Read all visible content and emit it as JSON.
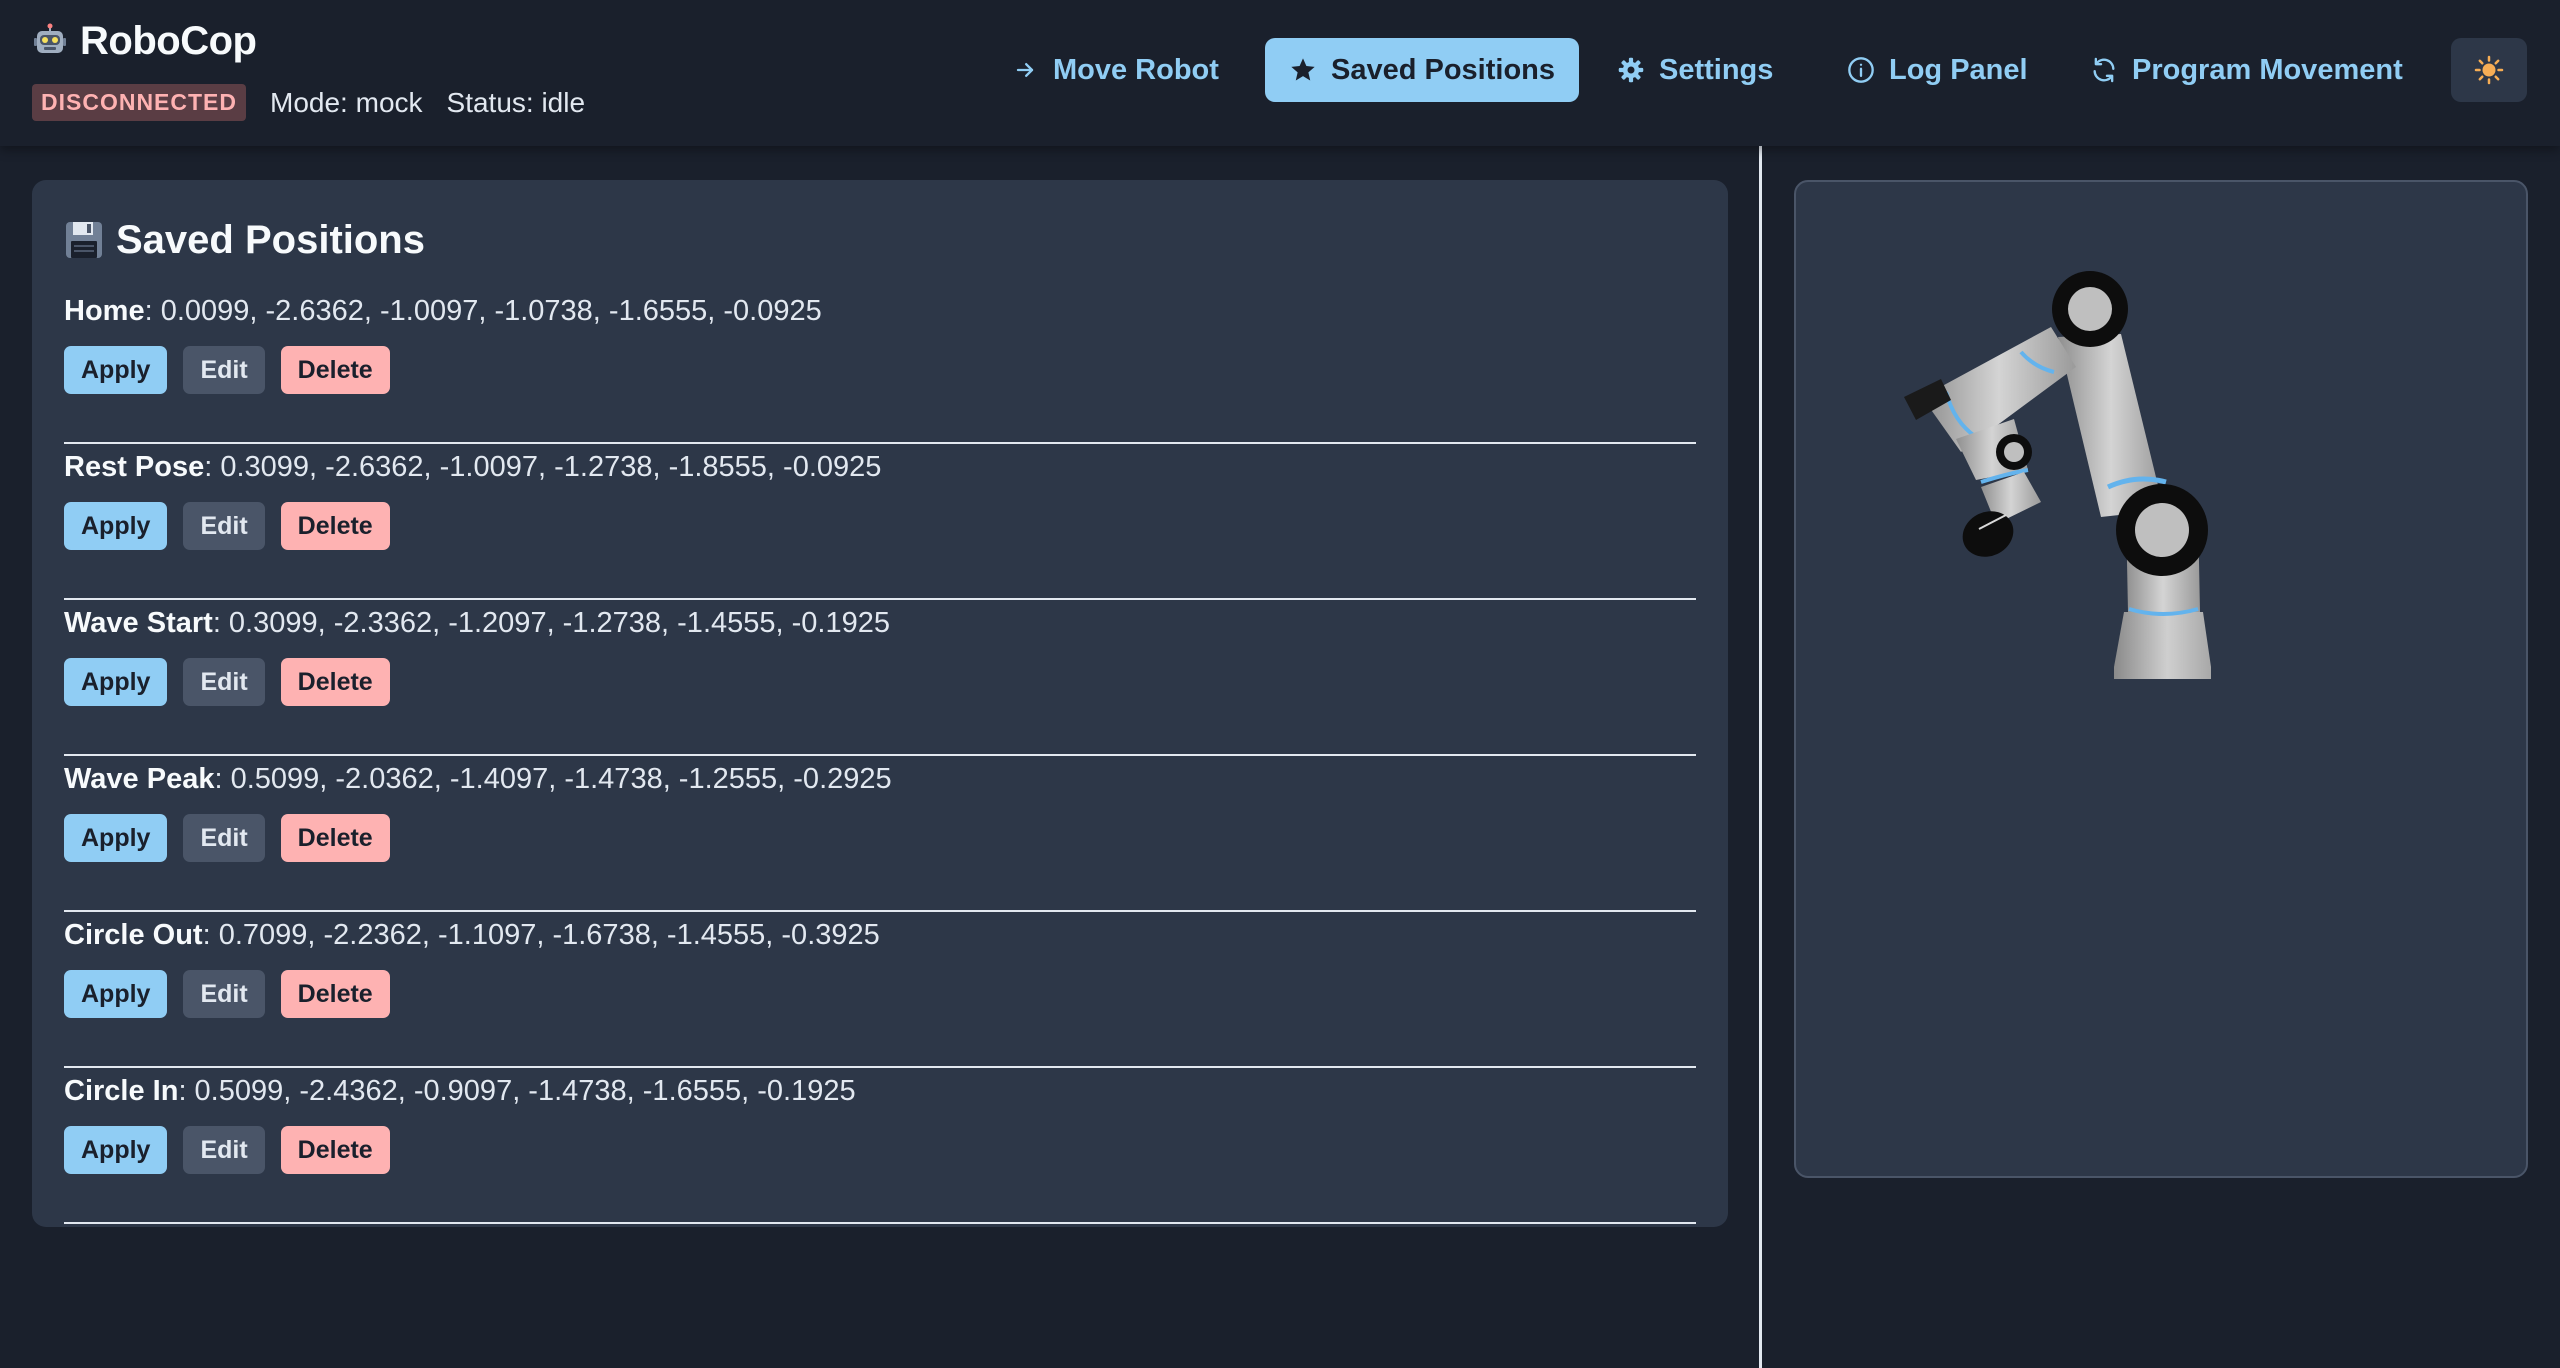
{
  "app": {
    "title": "RoboCop",
    "connection_badge": "DISCONNECTED",
    "mode": "Mode: mock",
    "status": "Status: idle"
  },
  "nav": {
    "items": [
      {
        "label": "Move Robot",
        "icon": "arrow-right-icon",
        "active": false
      },
      {
        "label": "Saved Positions",
        "icon": "star-icon",
        "active": true
      },
      {
        "label": "Settings",
        "icon": "gear-icon",
        "active": false
      },
      {
        "label": "Log Panel",
        "icon": "info-icon",
        "active": false
      },
      {
        "label": "Program Movement",
        "icon": "refresh-icon",
        "active": false
      }
    ],
    "theme_toggle_icon": "sun-icon"
  },
  "saved": {
    "title": "Saved Positions",
    "title_icon": "floppy-disk-icon",
    "positions": [
      {
        "name": "Home",
        "values": ": 0.0099, -2.6362, -1.0097, -1.0738, -1.6555, -0.0925"
      },
      {
        "name": "Rest Pose",
        "values": ": 0.3099, -2.6362, -1.0097, -1.2738, -1.8555, -0.0925"
      },
      {
        "name": "Wave Start",
        "values": ": 0.3099, -2.3362, -1.2097, -1.2738, -1.4555, -0.1925"
      },
      {
        "name": "Wave Peak",
        "values": ": 0.5099, -2.0362, -1.4097, -1.4738, -1.2555, -0.2925"
      },
      {
        "name": "Circle Out",
        "values": ": 0.7099, -2.2362, -1.1097, -1.6738, -1.4555, -0.3925"
      },
      {
        "name": "Circle In",
        "values": ": 0.5099, -2.4362, -0.9097, -1.4738, -1.6555, -0.1925"
      }
    ],
    "buttons": {
      "apply": "Apply",
      "edit": "Edit",
      "delete": "Delete"
    }
  },
  "colors": {
    "background": "#1a202c",
    "panel": "#2d3748",
    "accent": "#90cdf4",
    "danger": "#feb2b2"
  }
}
